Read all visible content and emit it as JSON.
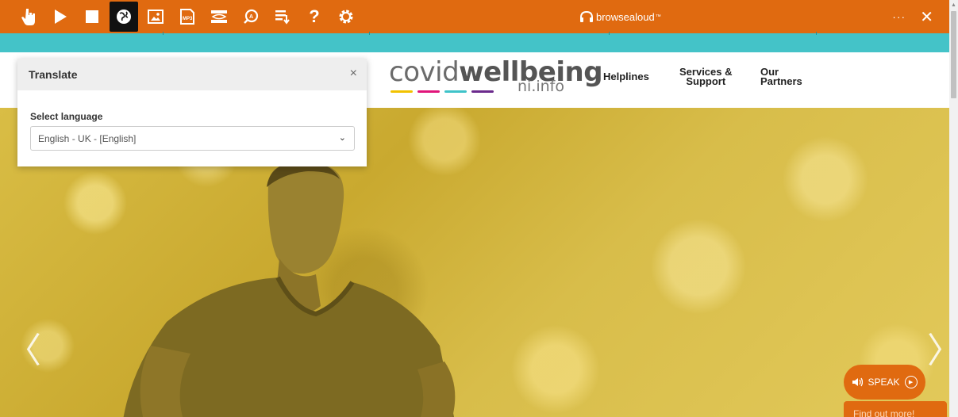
{
  "toolbar": {
    "buttons": [
      {
        "icon": "hand-pointer-icon"
      },
      {
        "icon": "play-icon"
      },
      {
        "icon": "stop-icon"
      },
      {
        "icon": "globe-translate-icon",
        "active": true
      },
      {
        "icon": "picture-icon"
      },
      {
        "icon": "mp3-icon",
        "text": "MP3"
      },
      {
        "icon": "screen-mask-icon"
      },
      {
        "icon": "magnifier-icon"
      },
      {
        "icon": "webpage-simplifier-icon"
      },
      {
        "icon": "help-icon",
        "text": "?"
      },
      {
        "icon": "settings-gear-icon"
      }
    ],
    "brand": "browsealoud",
    "brand_tm": "™",
    "more": "···",
    "close": "✕"
  },
  "header": {
    "logo": {
      "light": "covid",
      "bold": "wellbeing",
      "sub": "ni.info",
      "bar_colors": [
        "#f2c200",
        "#e0157a",
        "#3fc3c9",
        "#6b2a8c"
      ]
    },
    "nav": {
      "helplines": "Helplines",
      "services": "Services &\nSupport",
      "partners": "Our\nPartners"
    }
  },
  "translate_panel": {
    "title": "Translate",
    "close": "×",
    "label": "Select language",
    "selected": "English - UK - [English]",
    "chevron": "⌄"
  },
  "hero": {
    "prev": "〈",
    "next": "〉"
  },
  "speak_button": {
    "label": "SPEAK",
    "icon": "speaker-icon"
  },
  "find_more": "Find out more!",
  "colors": {
    "toolbar": "#e06a10",
    "teal_banner": "#44c3c8",
    "hero_tint": "#d4b840"
  }
}
